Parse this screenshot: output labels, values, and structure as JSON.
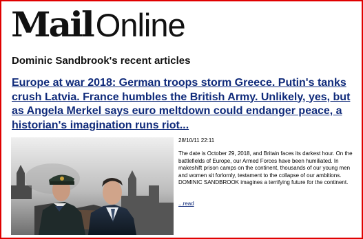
{
  "brand": {
    "logo_mail": "Mail",
    "logo_online": "Online"
  },
  "author_section": {
    "heading": "Dominic Sandbrook's recent articles"
  },
  "article": {
    "headline": "Europe at war 2018: German troops storm Greece. Putin's tanks crush Latvia. France humbles the British Army. Unlikely, yes, but as Angela Merkel says euro meltdown could endanger peace, a historian's imagination runs riot...",
    "timestamp": "28/10/11 22:11",
    "summary": "The date is October 29, 2018, and Britain faces its darkest hour. On the battlefields of Europe, our Armed Forces have been humiliated. In makeshift prison camps on the continent, thousands of our young men and women sit forlornly, testament to the collapse of our ambitions. DOMINIC SANDBROOK imagines a terrifying future for the continent.",
    "read_more": "...read"
  },
  "colors": {
    "frame_border": "#e00000",
    "link": "#0f2a7a",
    "text": "#000000"
  }
}
